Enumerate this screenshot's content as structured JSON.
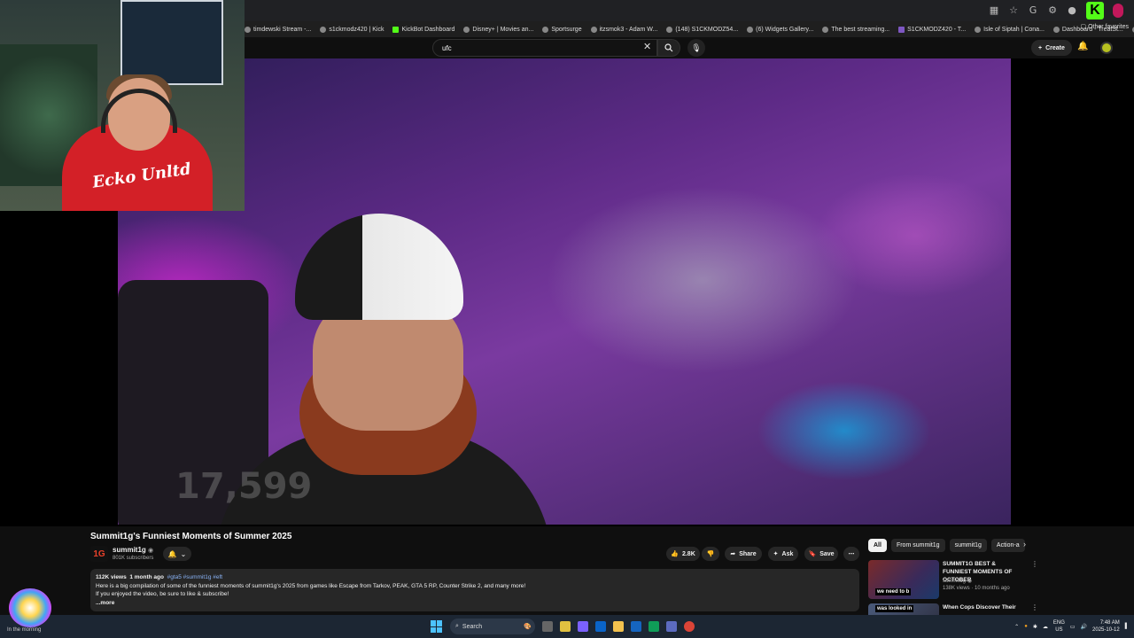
{
  "browser": {
    "bookmarks": [
      {
        "label": "timdewski Stream -...",
        "fav": "g"
      },
      {
        "label": "s1ckmodz420 | Kick",
        "fav": "g"
      },
      {
        "label": "KickBot Dashboard",
        "fav": "k"
      },
      {
        "label": "Disney+ | Movies an...",
        "fav": "g"
      },
      {
        "label": "Sportsurge",
        "fav": "g"
      },
      {
        "label": "itzsmok3 - Adam W...",
        "fav": "g"
      },
      {
        "label": "(148) S1CKMODZ54...",
        "fav": "g"
      },
      {
        "label": "(6) Widgets Gallery...",
        "fav": "g"
      },
      {
        "label": "The best streaming...",
        "fav": "g"
      },
      {
        "label": "S1CKMODZ420 - T...",
        "fav": "b"
      },
      {
        "label": "Isle of Siptah | Cona...",
        "fav": "g"
      },
      {
        "label": "Dashboard - TreatSt...",
        "fav": "g"
      },
      {
        "label": "s1ckmodz420 - Kic...",
        "fav": "g"
      }
    ],
    "other_favorites": "Other favorites"
  },
  "header": {
    "search_value": "ufc",
    "create_label": "Create"
  },
  "video": {
    "title": "Summit1g's Funniest Moments of Summer 2025",
    "counter_overlay": "17,599",
    "webcam_shirt_text": "Ecko Unltd"
  },
  "channel": {
    "logo_text": "1G",
    "name": "summit1g",
    "subscribers": "801K subscribers"
  },
  "actions": {
    "likes": "2.8K",
    "share": "Share",
    "ask": "Ask",
    "save": "Save"
  },
  "description": {
    "views": "112K views",
    "age": "1 month ago",
    "tags": "#gta5 #summit1g #eft",
    "line1": "Here is a big compilation of some of the funniest moments of summit1g's 2025 from games like Escape from Tarkov, PEAK, GTA 5 RP, Counter Strike 2, and many more!",
    "line2": "If you enjoyed the video, be sure to like & subscribe!",
    "more": "...more"
  },
  "sidebar": {
    "chips": [
      "All",
      "From summit1g",
      "summit1g",
      "Action-a"
    ],
    "recommendations": [
      {
        "title": "SUMMIT1G BEST & FUNNIEST MOMENTS OF OCTOBER",
        "channel": "summit1g",
        "meta": "138K views · 10 months ago",
        "thumb_caption": "we need to b"
      },
      {
        "title": "When Cops Discover Their",
        "channel": "",
        "meta": "",
        "thumb_caption": "was looked in"
      }
    ]
  },
  "taskbar": {
    "weather": "In the morning",
    "search": "Search",
    "lang_top": "ENG",
    "lang_bottom": "US",
    "time": "7:48 AM",
    "date": "2025-10-12"
  }
}
